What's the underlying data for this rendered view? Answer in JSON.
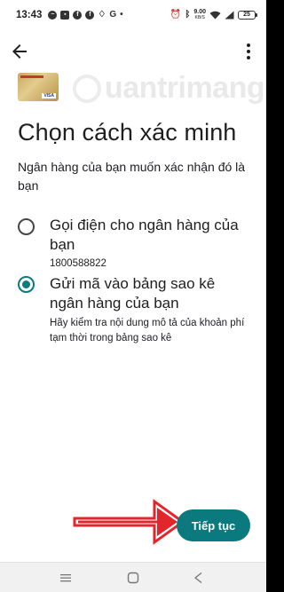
{
  "status_bar": {
    "time": "13:43",
    "speed_value": "9.00",
    "speed_unit": "KB/S",
    "battery": "25"
  },
  "icons": {
    "back": "arrow-back-icon",
    "menu": "more-vertical-icon"
  },
  "watermark": {
    "text": "uantrimang"
  },
  "page": {
    "title": "Chọn cách xác minh",
    "subtitle": "Ngân hàng của bạn muốn xác nhận đó là bạn"
  },
  "options": [
    {
      "title": "Gọi điện cho ngân hàng của bạn",
      "detail": "1800588822",
      "selected": false
    },
    {
      "title": "Gửi mã vào bảng sao kê ngân hàng của bạn",
      "detail": "Hãy kiểm tra nội dung mô tả của khoản phí tạm thời trong bảng sao kê",
      "selected": true
    }
  ],
  "actions": {
    "continue_label": "Tiếp tục"
  },
  "colors": {
    "accent": "#0b7a7e",
    "annotation_arrow": "#e3262b"
  }
}
